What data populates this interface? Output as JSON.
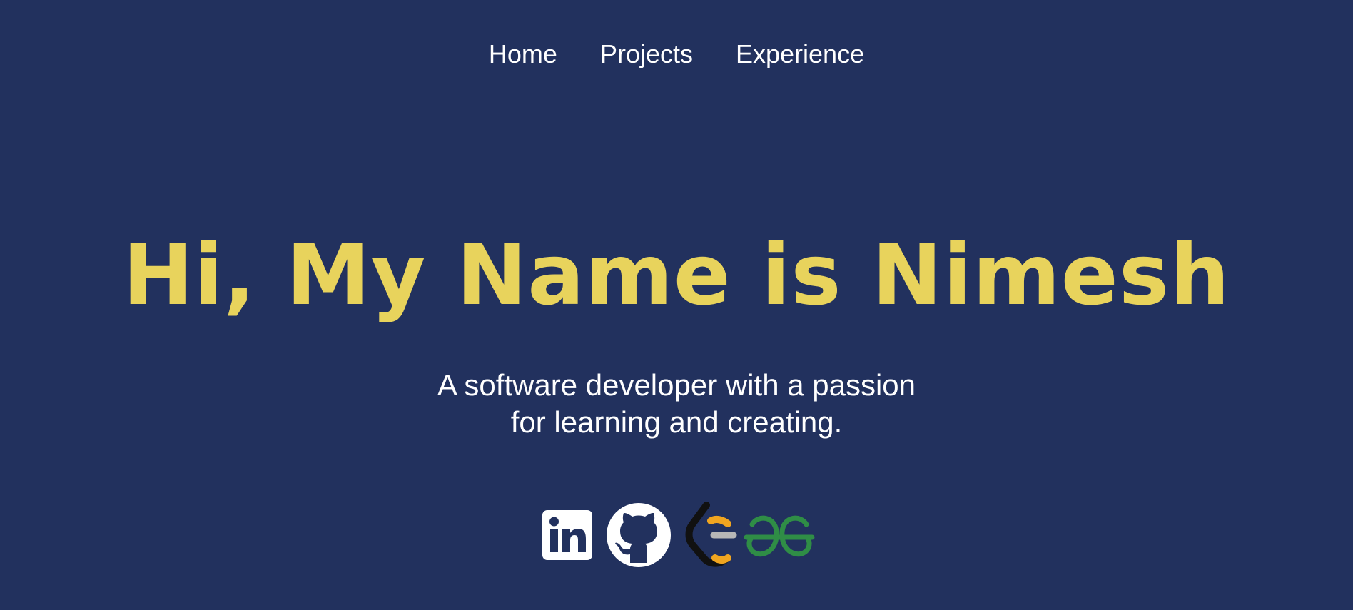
{
  "nav": {
    "items": [
      {
        "label": "Home"
      },
      {
        "label": "Projects"
      },
      {
        "label": "Experience"
      }
    ]
  },
  "hero": {
    "title": "Hi, My Name is Nimesh",
    "tagline_line1": "A software developer with a passion",
    "tagline_line2": "for learning and creating."
  },
  "socials": [
    {
      "name": "linkedin-icon"
    },
    {
      "name": "github-icon"
    },
    {
      "name": "leetcode-icon"
    },
    {
      "name": "geeksforgeeks-icon"
    }
  ],
  "colors": {
    "background": "#22315e",
    "accent": "#e8d35c",
    "text": "#ffffff",
    "leetcode_orange": "#f0a520",
    "gfg_green": "#2f8d46"
  }
}
